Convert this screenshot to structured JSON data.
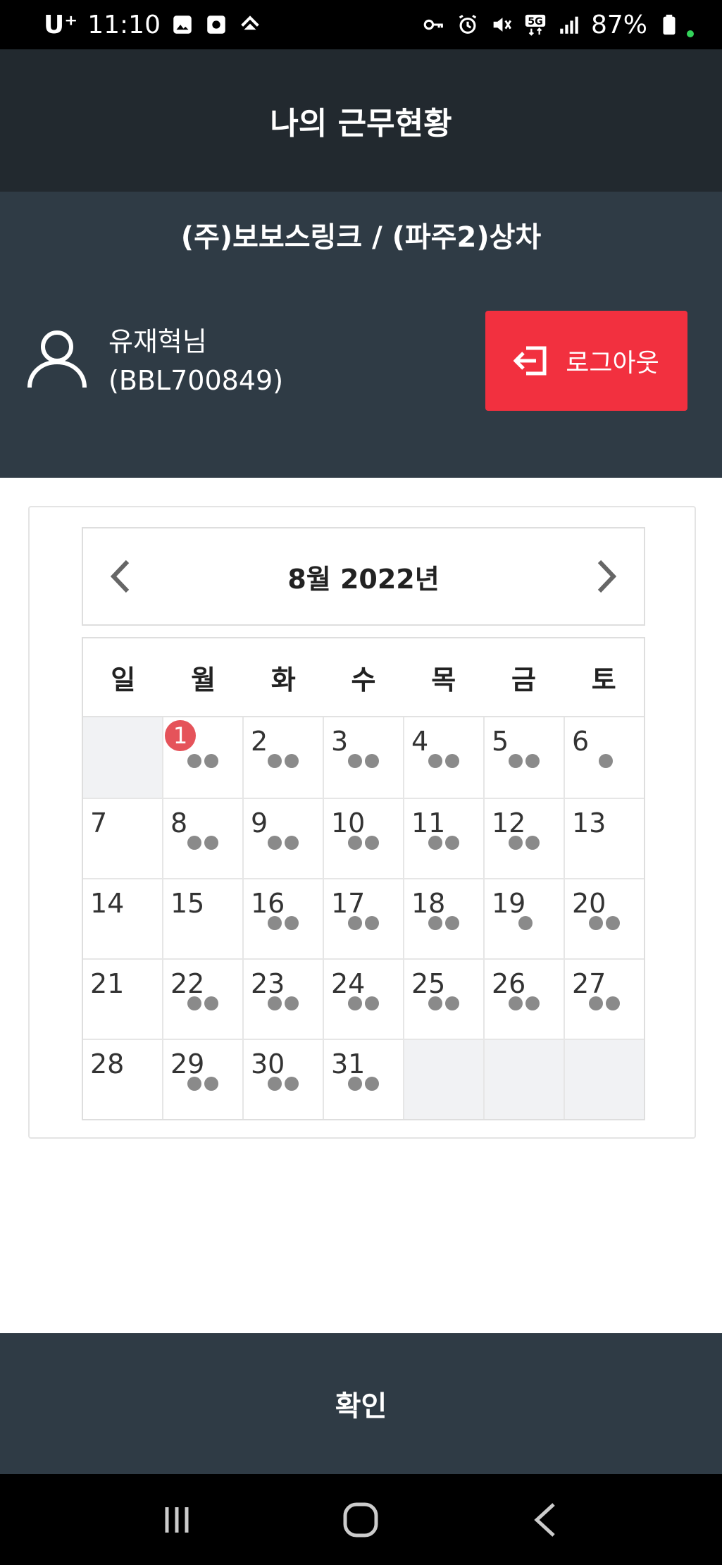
{
  "status_bar": {
    "carrier": "U⁺",
    "time": "11:10",
    "battery": "87%"
  },
  "header": {
    "title": "나의 근무현황"
  },
  "info": {
    "company": "(주)보보스링크 / (파주2)상차",
    "user_name": "유재혁님",
    "user_id": "(BBL700849)",
    "logout_label": "로그아웃"
  },
  "calendar": {
    "month_title": "8월 2022년",
    "weekdays": [
      "일",
      "월",
      "화",
      "수",
      "목",
      "금",
      "토"
    ],
    "weeks": [
      [
        {
          "day": "",
          "dots": 0
        },
        {
          "day": "1",
          "dots": 2,
          "today": true
        },
        {
          "day": "2",
          "dots": 2
        },
        {
          "day": "3",
          "dots": 2
        },
        {
          "day": "4",
          "dots": 2
        },
        {
          "day": "5",
          "dots": 2
        },
        {
          "day": "6",
          "dots": 1
        }
      ],
      [
        {
          "day": "7",
          "dots": 0
        },
        {
          "day": "8",
          "dots": 2
        },
        {
          "day": "9",
          "dots": 2
        },
        {
          "day": "10",
          "dots": 2
        },
        {
          "day": "11",
          "dots": 2
        },
        {
          "day": "12",
          "dots": 2
        },
        {
          "day": "13",
          "dots": 0
        }
      ],
      [
        {
          "day": "14",
          "dots": 0
        },
        {
          "day": "15",
          "dots": 0
        },
        {
          "day": "16",
          "dots": 2
        },
        {
          "day": "17",
          "dots": 2
        },
        {
          "day": "18",
          "dots": 2
        },
        {
          "day": "19",
          "dots": 1
        },
        {
          "day": "20",
          "dots": 2
        }
      ],
      [
        {
          "day": "21",
          "dots": 0
        },
        {
          "day": "22",
          "dots": 2
        },
        {
          "day": "23",
          "dots": 2
        },
        {
          "day": "24",
          "dots": 2
        },
        {
          "day": "25",
          "dots": 2
        },
        {
          "day": "26",
          "dots": 2
        },
        {
          "day": "27",
          "dots": 2
        }
      ],
      [
        {
          "day": "28",
          "dots": 0
        },
        {
          "day": "29",
          "dots": 2
        },
        {
          "day": "30",
          "dots": 2
        },
        {
          "day": "31",
          "dots": 2
        },
        {
          "day": "",
          "dots": 0
        },
        {
          "day": "",
          "dots": 0
        },
        {
          "day": "",
          "dots": 0
        }
      ]
    ]
  },
  "footer": {
    "confirm_label": "확인"
  },
  "colors": {
    "header_bg": "#22292f",
    "panel_bg": "#2f3b45",
    "logout_red": "#f2303f",
    "today_badge": "#e5535a",
    "dot_gray": "#8a8a8a"
  },
  "icons": {
    "prev": "chevron-left-icon",
    "next": "chevron-right-icon",
    "user": "user-outline-icon",
    "logout": "logout-icon"
  }
}
